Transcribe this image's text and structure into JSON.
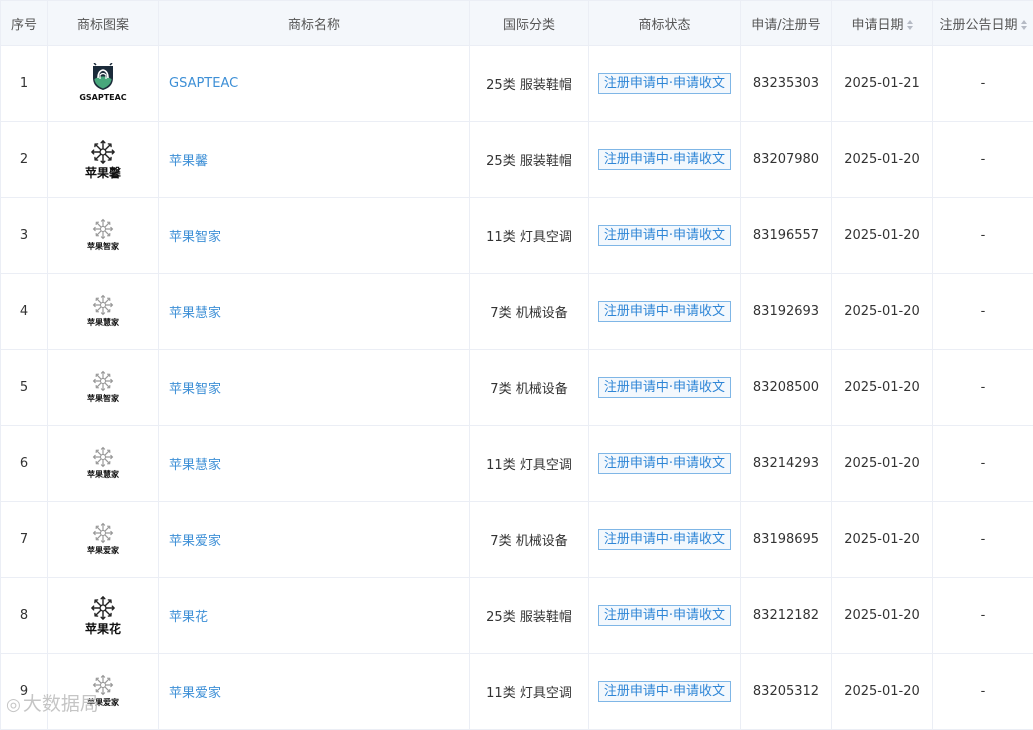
{
  "columns": {
    "seq": "序号",
    "image": "商标图案",
    "name": "商标名称",
    "class": "国际分类",
    "status": "商标状态",
    "regno": "申请/注册号",
    "appdate": "申请日期",
    "pubdate": "注册公告日期"
  },
  "colors": {
    "header_bg": "#f4f7fb",
    "link": "#3d8fd6",
    "status_border": "#7fb6e6",
    "status_text": "#2f86d6"
  },
  "rows": [
    {
      "seq": "1",
      "logo_text": "GSAPTEAC",
      "logo_icon": "horse-shield-icon",
      "name": "GSAPTEAC",
      "class": "25类 服装鞋帽",
      "status": "注册申请中·申请收文",
      "regno": "83235303",
      "appdate": "2025-01-21",
      "pubdate": "-"
    },
    {
      "seq": "2",
      "logo_text": "苹果馨",
      "logo_icon": "snowflake-flower-icon",
      "name": "苹果馨",
      "class": "25类 服装鞋帽",
      "status": "注册申请中·申请收文",
      "regno": "83207980",
      "appdate": "2025-01-20",
      "pubdate": "-"
    },
    {
      "seq": "3",
      "logo_text": "苹果智家",
      "logo_icon": "snowflake-flower-icon",
      "name": "苹果智家",
      "class": "11类 灯具空调",
      "status": "注册申请中·申请收文",
      "regno": "83196557",
      "appdate": "2025-01-20",
      "pubdate": "-"
    },
    {
      "seq": "4",
      "logo_text": "苹果慧家",
      "logo_icon": "snowflake-flower-icon",
      "name": "苹果慧家",
      "class": "7类 机械设备",
      "status": "注册申请中·申请收文",
      "regno": "83192693",
      "appdate": "2025-01-20",
      "pubdate": "-"
    },
    {
      "seq": "5",
      "logo_text": "苹果智家",
      "logo_icon": "snowflake-flower-icon",
      "name": "苹果智家",
      "class": "7类 机械设备",
      "status": "注册申请中·申请收文",
      "regno": "83208500",
      "appdate": "2025-01-20",
      "pubdate": "-"
    },
    {
      "seq": "6",
      "logo_text": "苹果慧家",
      "logo_icon": "snowflake-flower-icon",
      "name": "苹果慧家",
      "class": "11类 灯具空调",
      "status": "注册申请中·申请收文",
      "regno": "83214293",
      "appdate": "2025-01-20",
      "pubdate": "-"
    },
    {
      "seq": "7",
      "logo_text": "苹果爱家",
      "logo_icon": "snowflake-flower-icon",
      "name": "苹果爱家",
      "class": "7类 机械设备",
      "status": "注册申请中·申请收文",
      "regno": "83198695",
      "appdate": "2025-01-20",
      "pubdate": "-"
    },
    {
      "seq": "8",
      "logo_text": "苹果花",
      "logo_icon": "snowflake-flower-icon",
      "name": "苹果花",
      "class": "25类 服装鞋帽",
      "status": "注册申请中·申请收文",
      "regno": "83212182",
      "appdate": "2025-01-20",
      "pubdate": "-"
    },
    {
      "seq": "9",
      "logo_text": "苹果爱家",
      "logo_icon": "snowflake-flower-icon",
      "name": "苹果爱家",
      "class": "11类 灯具空调",
      "status": "注册申请中·申请收文",
      "regno": "83205312",
      "appdate": "2025-01-20",
      "pubdate": "-"
    }
  ],
  "watermark": {
    "text": "大数据局",
    "icon": "mascot-icon"
  }
}
